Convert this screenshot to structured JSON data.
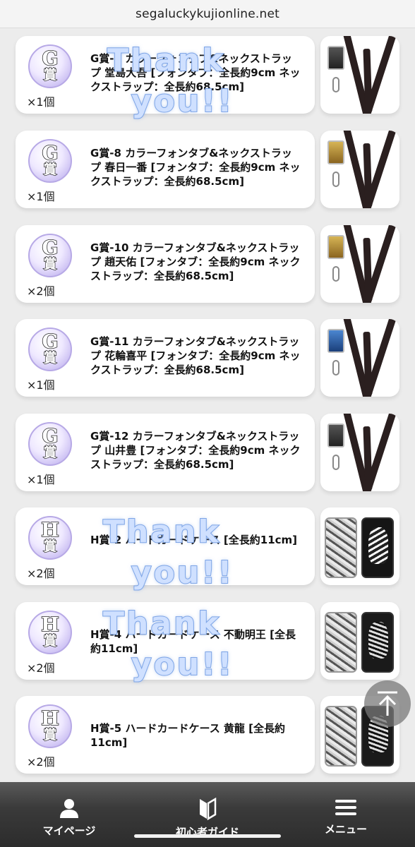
{
  "browser": {
    "url": "segaluckykujionline.net"
  },
  "items": [
    {
      "grade": "G",
      "suffix": "賞",
      "qty": "×1個",
      "title": "G賞-4 カラーフォンタブ&ネックストラップ 堂島大吾 [フォンタブ：全長約9cm ネックストラップ：全長約68.5cm]",
      "thumb": "lanyard"
    },
    {
      "grade": "G",
      "suffix": "賞",
      "qty": "×1個",
      "title": "G賞-8 カラーフォンタブ&ネックストラップ 春日一番 [フォンタブ：全長約9cm ネックストラップ：全長約68.5cm]",
      "thumb": "lanyard-gold"
    },
    {
      "grade": "G",
      "suffix": "賞",
      "qty": "×2個",
      "title": "G賞-10 カラーフォンタブ&ネックストラップ 趙天佑 [フォンタブ：全長約9cm ネックストラップ：全長約68.5cm]",
      "thumb": "lanyard-gold"
    },
    {
      "grade": "G",
      "suffix": "賞",
      "qty": "×1個",
      "title": "G賞-11 カラーフォンタブ&ネックストラップ 花輪喜平 [フォンタブ：全長約9cm ネックストラップ：全長約68.5cm]",
      "thumb": "lanyard-blue"
    },
    {
      "grade": "G",
      "suffix": "賞",
      "qty": "×1個",
      "title": "G賞-12 カラーフォンタブ&ネックストラップ 山井豊 [フォンタブ：全長約9cm ネックストラップ：全長約68.5cm]",
      "thumb": "lanyard"
    },
    {
      "grade": "H",
      "suffix": "賞",
      "qty": "×2個",
      "title": "H賞-2 ハードカードケース [全長約11cm]",
      "thumb": "case"
    },
    {
      "grade": "H",
      "suffix": "賞",
      "qty": "×2個",
      "title": "H賞-4 ハードカードケース 不動明王 [全長約11cm]",
      "thumb": "case-light"
    },
    {
      "grade": "H",
      "suffix": "賞",
      "qty": "×2個",
      "title": "H賞-5 ハードカードケース 黄龍 [全長約11cm]",
      "thumb": "case-light"
    }
  ],
  "watermark": {
    "line1": "Thank",
    "line2": "you!!"
  },
  "nav": [
    {
      "label": "マイページ",
      "icon": "person-icon"
    },
    {
      "label": "初心者ガイド",
      "icon": "beginner-mark-icon"
    },
    {
      "label": "メニュー",
      "icon": "hamburger-menu-icon"
    }
  ],
  "colors": {
    "page_bg": "#ececec",
    "card_bg": "#ffffff",
    "badge_purple": "#b7a9e6",
    "nav_bg": "#2c2c2c",
    "watermark_blue": "#cfe0ff"
  }
}
